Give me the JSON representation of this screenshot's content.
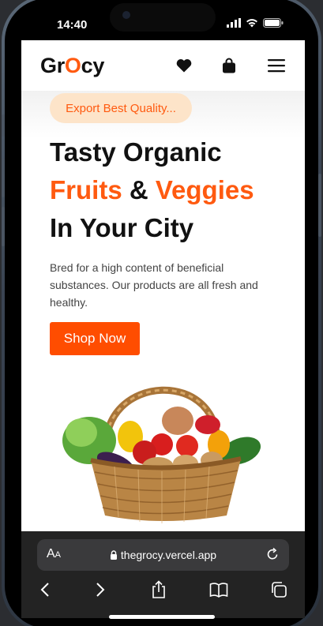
{
  "status_bar": {
    "time": "14:40"
  },
  "nav": {
    "logo_pre": "Gr",
    "logo_o": "O",
    "logo_post": "cy",
    "icons": [
      "heart-icon",
      "bag-icon",
      "menu-icon"
    ]
  },
  "hero": {
    "badge": "Export Best Quality...",
    "headline_line1": "Tasty Organic",
    "headline_fruits": "Fruits",
    "headline_amp": " & ",
    "headline_veggies": "Veggies",
    "headline_line3": "In Your City",
    "description": "Bred for a high content of beneficial substances. Our products are all fresh and healthy.",
    "cta": "Shop Now"
  },
  "browser": {
    "aa_label": "A",
    "aa_small": "A",
    "url": "thegrocy.vercel.app",
    "toolbar_icons": [
      "back-icon",
      "forward-icon",
      "share-icon",
      "bookmarks-icon",
      "tabs-icon"
    ]
  },
  "colors": {
    "brand_orange": "#ff5a10",
    "button_orange": "#ff4d00",
    "badge_bg": "#fde4c9"
  }
}
